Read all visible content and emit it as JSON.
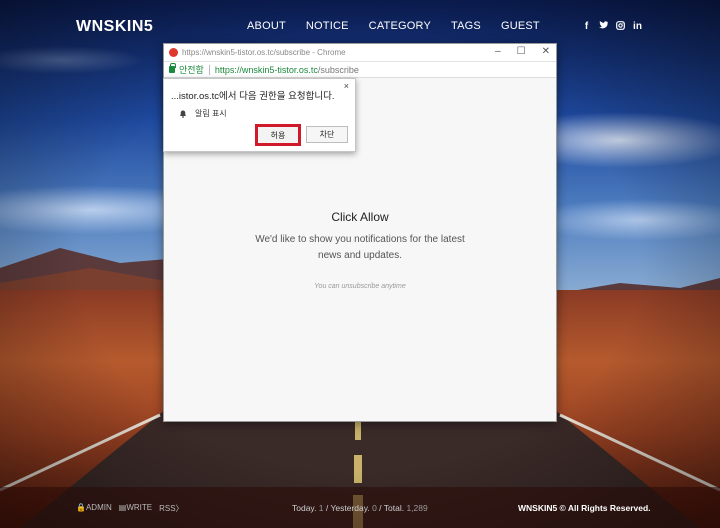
{
  "site": {
    "logo": "WNSKIN5",
    "nav": [
      "ABOUT",
      "NOTICE",
      "CATEGORY",
      "TAGS",
      "GUEST"
    ],
    "social_icons": [
      "facebook-icon",
      "twitter-icon",
      "instagram-icon",
      "linkedin-icon"
    ],
    "social_glyphs": [
      "f",
      "t",
      "ig",
      "in"
    ]
  },
  "popup_window": {
    "title": "https://wnskin5-tistor.os.tc/subscribe - Chrome",
    "secure_label": "안전함",
    "url_host": "https://wnskin5-tistor.os.tc",
    "url_path": "/subscribe",
    "heading": "Click Allow",
    "message_line1": "We'd like to show you notifications for the latest",
    "message_line2": "news and updates.",
    "unsubscribe_note": "You can unsubscribe anytime"
  },
  "permission_prompt": {
    "title": "...istor.os.tc에서 다음 권한을 요청합니다.",
    "permission": "알림 표시",
    "allow_label": "허용",
    "block_label": "차단",
    "close_glyph": "×",
    "highlight_color": "#d01a2b"
  },
  "footer": {
    "admin": "ADMIN",
    "write": "WRITE",
    "rss": "RSS",
    "today_label": "Today",
    "today": "1",
    "yesterday_label": "Yesterday",
    "yesterday": "0",
    "total_label": "Total",
    "total": "1,289",
    "copyright": "WNSKIN5 © All Rights Reserved."
  }
}
